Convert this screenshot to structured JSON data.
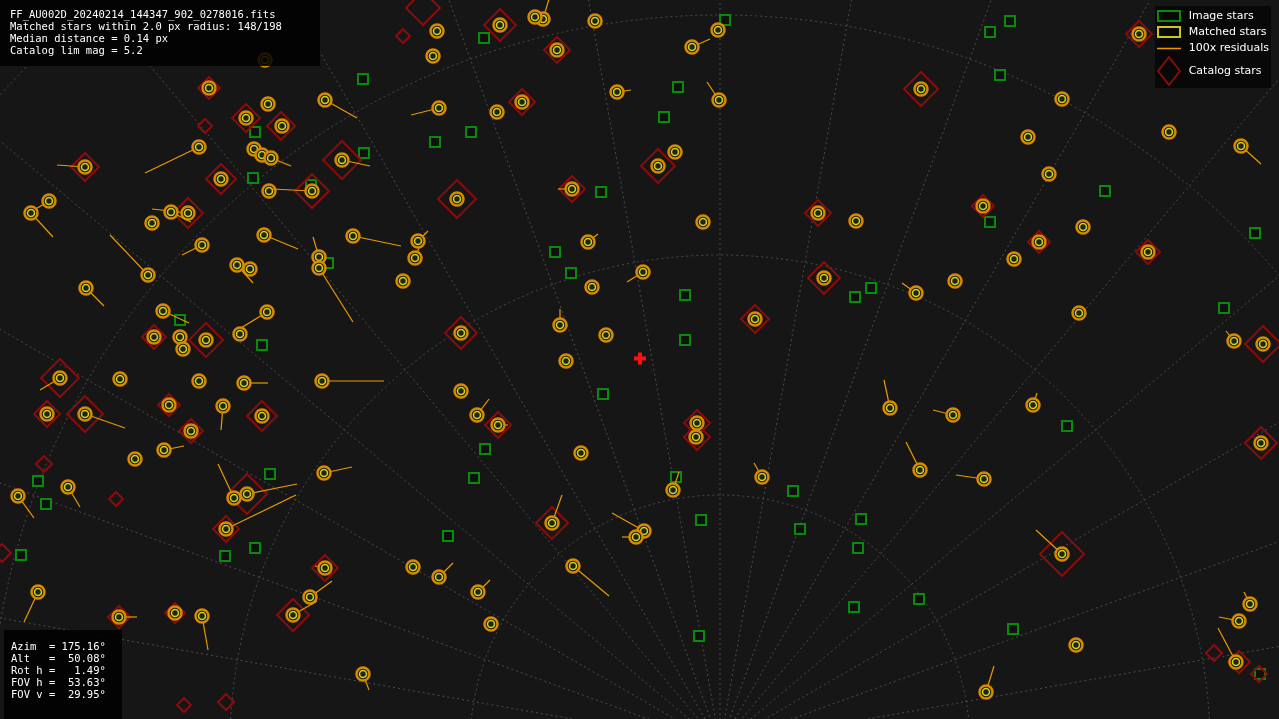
{
  "file_info": {
    "lines": [
      "FF_AU002D_20240214_144347_902_0278016.fits",
      "Matched stars within 2.0 px radius: 148/198",
      "Median distance = 0.14 px",
      "Catalog lim mag = 5.2"
    ]
  },
  "legend": {
    "items": [
      {
        "kind": "image",
        "label": "Image stars"
      },
      {
        "kind": "matched",
        "label": "Matched stars"
      },
      {
        "kind": "residual",
        "label": "100x residuals"
      },
      {
        "kind": "catalog",
        "label": "Catalog stars"
      }
    ]
  },
  "pointing": {
    "lines": [
      "Azim  = 175.16°",
      "Alt   =  50.08°",
      "Rot h =   1.49°",
      "FOV h =  53.63°",
      "FOV v =  29.95°"
    ]
  }
}
